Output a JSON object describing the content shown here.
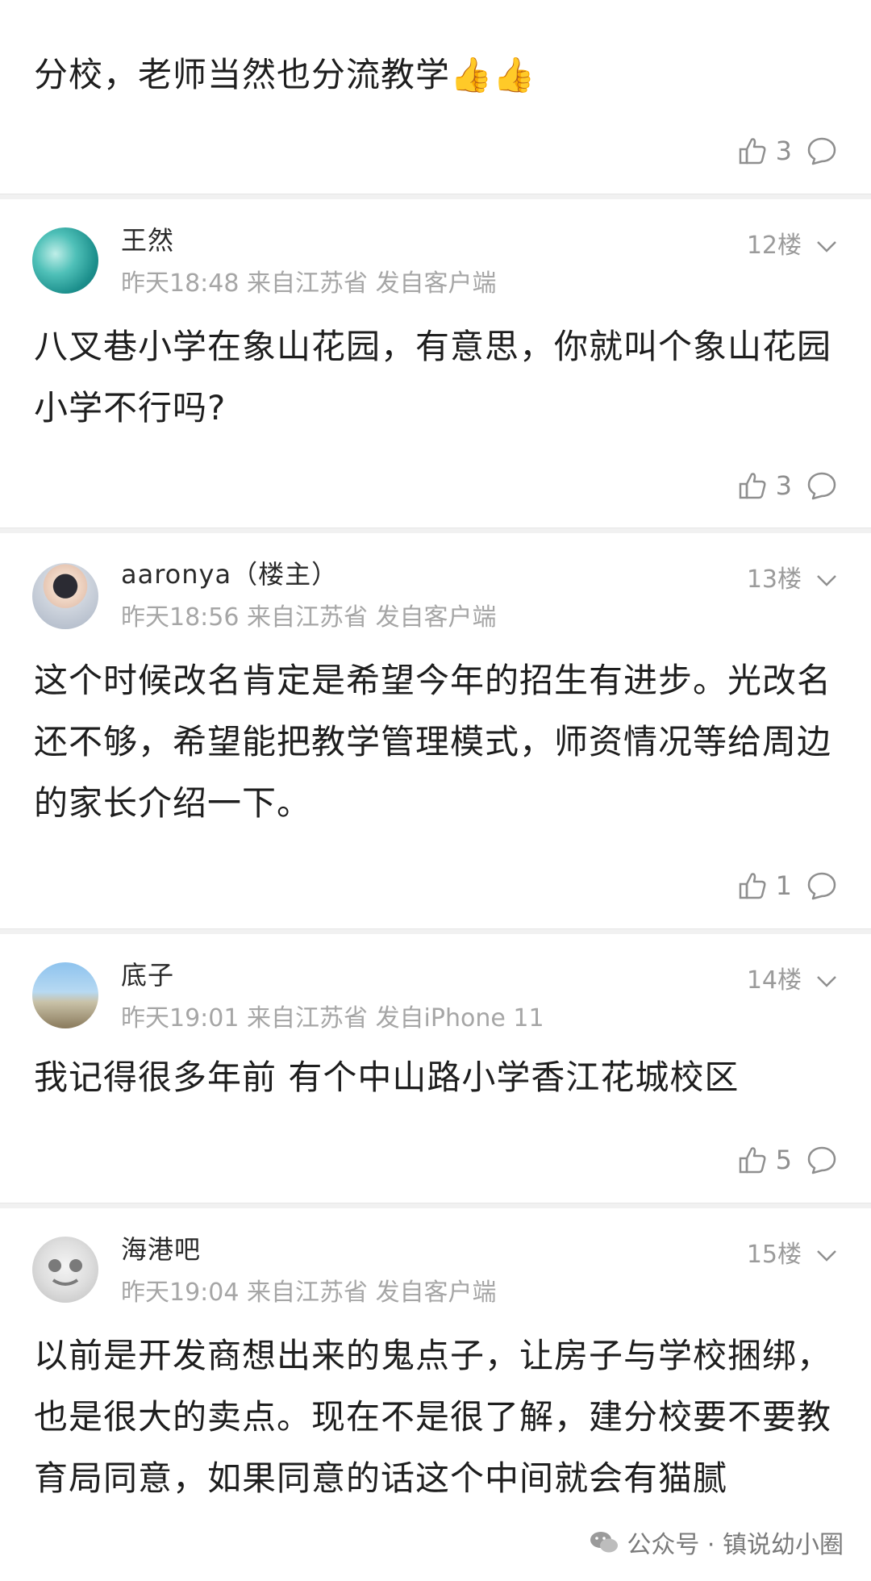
{
  "comments": [
    {
      "text": "分校，老师当然也分流教学👍👍",
      "likes": "3"
    },
    {
      "name": "王然",
      "time": "昨天18:48",
      "location": "来自江苏省",
      "client": "发自客户端",
      "floor": "12楼",
      "text": "八叉巷小学在象山花园，有意思，你就叫个象山花园小学不行吗?",
      "likes": "3"
    },
    {
      "name": "aaronya（楼主）",
      "time": "昨天18:56",
      "location": "来自江苏省",
      "client": "发自客户端",
      "floor": "13楼",
      "text": "这个时候改名肯定是希望今年的招生有进步。光改名还不够，希望能把教学管理模式，师资情况等给周边的家长介绍一下。",
      "likes": "1"
    },
    {
      "name": "底子",
      "time": "昨天19:01",
      "location": "来自江苏省",
      "client": "发自iPhone 11",
      "floor": "14楼",
      "text": "我记得很多年前 有个中山路小学香江花城校区",
      "likes": "5"
    },
    {
      "name": "海港吧",
      "time": "昨天19:04",
      "location": "来自江苏省",
      "client": "发自客户端",
      "floor": "15楼",
      "text": "以前是开发商想出来的鬼点子，让房子与学校捆绑，也是很大的卖点。现在不是很了解，建分校要不要教育局同意，如果同意的话这个中间就会有猫腻"
    }
  ],
  "watermark": {
    "source": "公众号 · 镇说幼小圈"
  },
  "icons": {
    "like": "thumbs-up-icon",
    "comment": "comment-bubble-icon",
    "expand": "chevron-down-icon",
    "wechat": "wechat-icon"
  },
  "colors": {
    "text": "#1e1e1e",
    "meta": "#a6a6a6",
    "separator": "#f1f1f1"
  }
}
